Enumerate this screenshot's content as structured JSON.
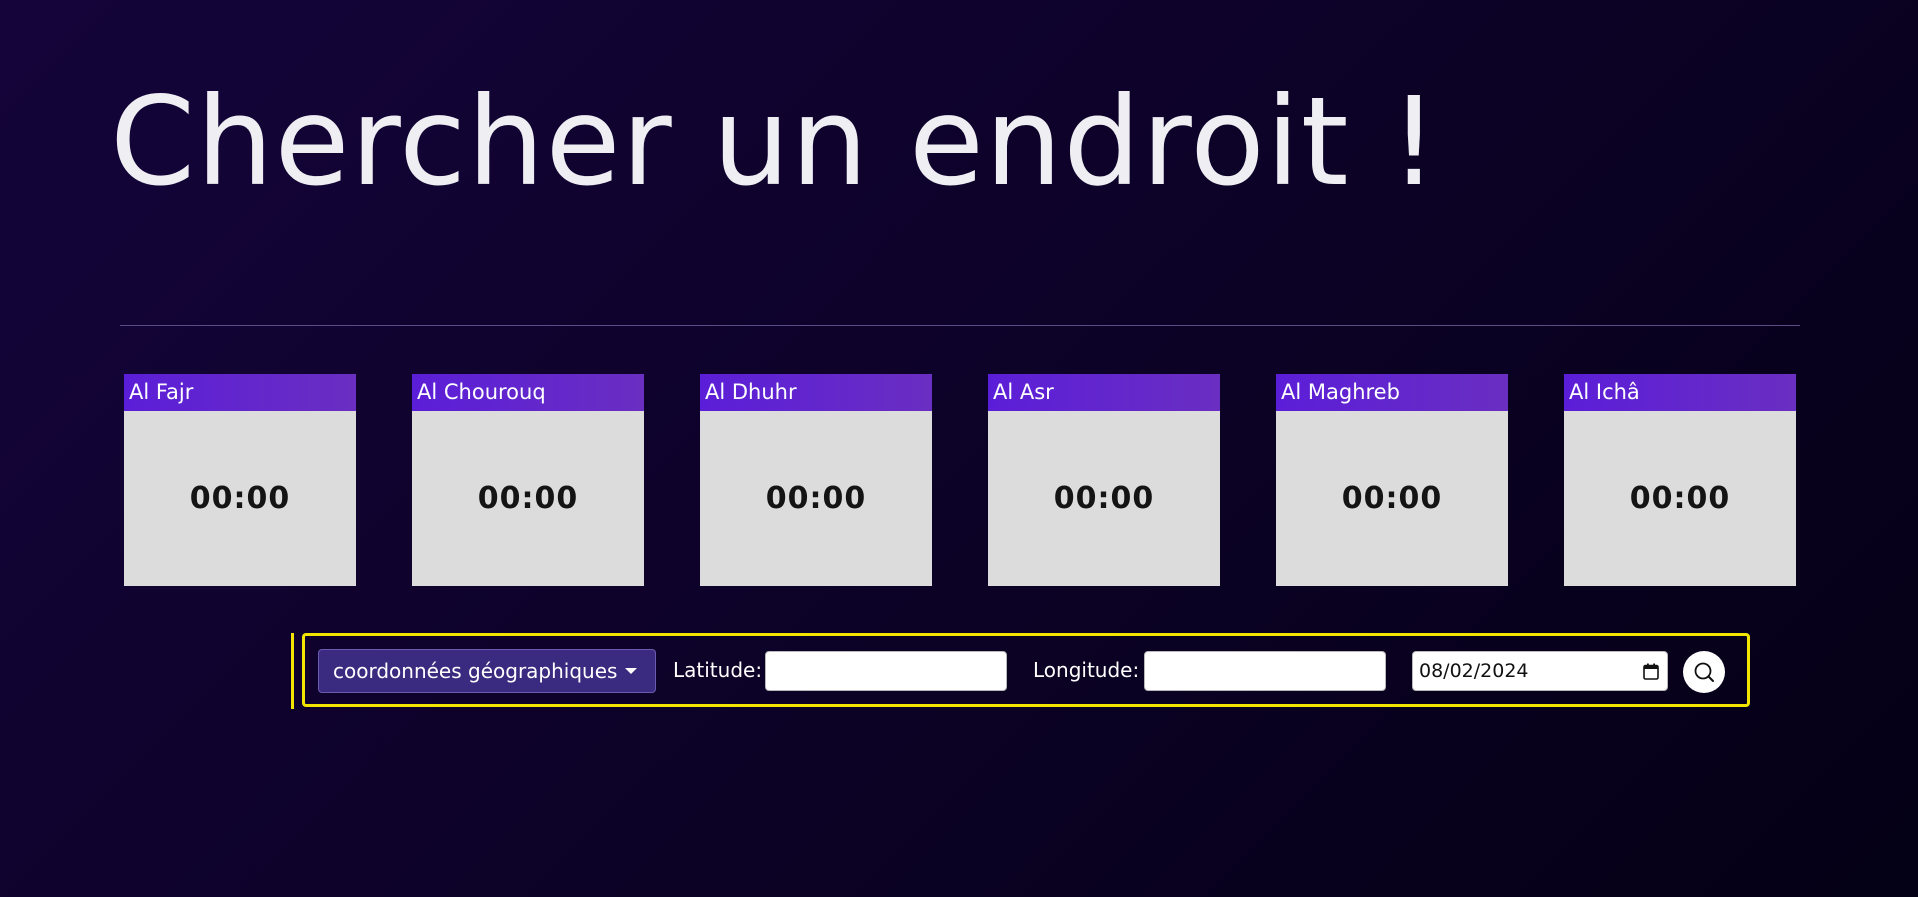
{
  "header": {
    "title": "Chercher un endroit !"
  },
  "prayers": [
    {
      "name": "Al Fajr",
      "time": "00:00"
    },
    {
      "name": "Al Chourouq",
      "time": "00:00"
    },
    {
      "name": "Al Dhuhr",
      "time": "00:00"
    },
    {
      "name": "Al Asr",
      "time": "00:00"
    },
    {
      "name": "Al Maghreb",
      "time": "00:00"
    },
    {
      "name": "Al Ichâ",
      "time": "00:00"
    }
  ],
  "search": {
    "mode_label": "coordonnées géographiques",
    "latitude_label": "Latitude:",
    "latitude_value": "",
    "longitude_label": "Longitude:",
    "longitude_value": "",
    "date_value": "08/02/2024",
    "search_icon": "search-icon",
    "calendar_icon": "calendar-icon",
    "dropdown_icon": "chevron-down-icon"
  },
  "colors": {
    "background": "#0c0226",
    "card_header": "#5b1ed8",
    "card_body": "#dcdcdc",
    "dropdown": "#3b2b80",
    "highlight": "#f2e600"
  }
}
